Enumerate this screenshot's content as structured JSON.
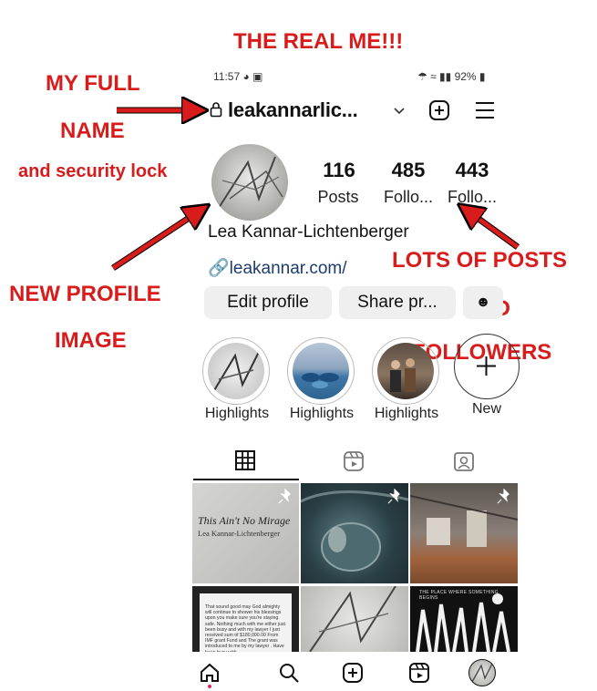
{
  "annotations": {
    "top": "THE REAL ME!!!",
    "name_line1": "MY FULL",
    "name_line2": "NAME",
    "lock_note": "and security lock",
    "new_profile_1": "NEW PROFILE",
    "new_profile_2": "IMAGE",
    "lots_1": "LOTS OF POSTS",
    "lots_2": "AND",
    "lots_3": "FOLLOWERS"
  },
  "status_bar": {
    "time": "11:57",
    "battery": "92%"
  },
  "header": {
    "username": "leakannarlic...",
    "lock_icon": "lock-icon",
    "dropdown_icon": "chevron-down-icon",
    "add_icon": "plus-square-icon",
    "menu_icon": "hamburger-icon"
  },
  "stats": [
    {
      "value": "116",
      "label": "Posts"
    },
    {
      "value": "485",
      "label": "Follo..."
    },
    {
      "value": "443",
      "label": "Follo..."
    }
  ],
  "profile": {
    "full_name": "Lea Kannar-Lichtenberger",
    "link": "leakannar.com/"
  },
  "buttons": {
    "edit": "Edit profile",
    "share": "Share pr..."
  },
  "highlights": [
    {
      "label": "Highlights"
    },
    {
      "label": "Highlights"
    },
    {
      "label": "Highlights"
    },
    {
      "label": "New"
    }
  ],
  "tabs": [
    "grid-icon",
    "reels-icon",
    "tagged-icon"
  ],
  "posts": {
    "p1_title": "This Ain't No Mirage",
    "p1_sub": "Lea Kannar-Lichtenberger",
    "p4_text": "That sound good may God almighty will continue to shower his blessings upon you make sure you're staying safe. Nothing much with me either just been busy and with my lawyer I just received sum of $180,000.00 From IMF grant Fund and The grant was introduced to me by my lawyer . Have been busy with",
    "p6_title": "THE PLACE WHERE SOMETHING BEGINS"
  },
  "bottom_nav": [
    "home-icon",
    "search-icon",
    "create-icon",
    "reels-icon",
    "profile-avatar"
  ],
  "colors": {
    "annotation": "#d81c1c",
    "link": "#1d3b6e",
    "button_bg": "#efefef"
  }
}
